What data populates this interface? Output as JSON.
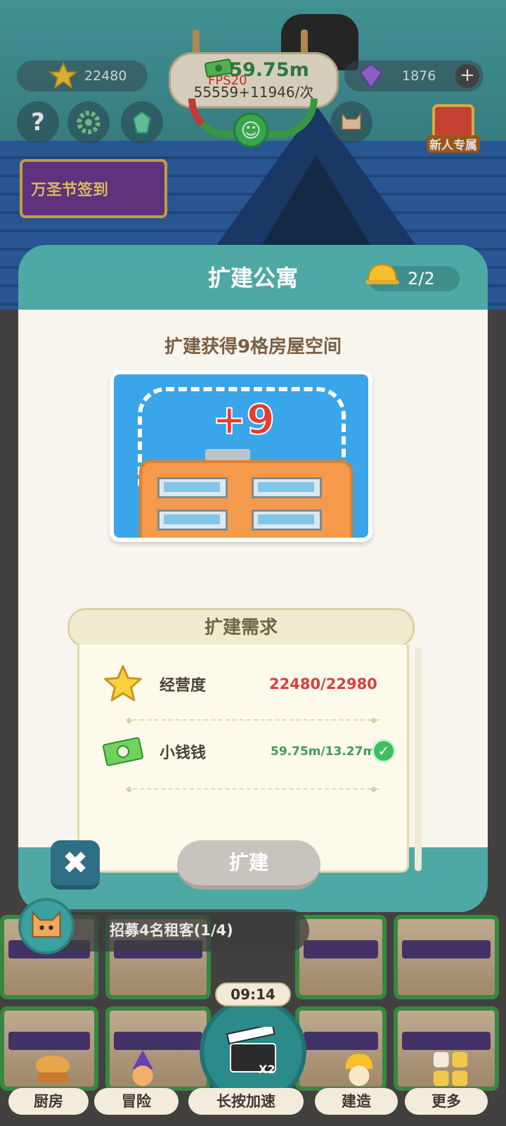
{
  "hud": {
    "stars": "22480",
    "money": "59.75m",
    "fps": "FPS20",
    "rate": "55559+11946/次",
    "gems": "1876"
  },
  "banners": {
    "halloween": "万圣节签到",
    "newbie": "新人专属"
  },
  "modal": {
    "title": "扩建公寓",
    "helmet_count": "2/2",
    "description": "扩建获得9格房屋空间",
    "preview_badge": "+9",
    "requirements_title": "扩建需求",
    "requirements": [
      {
        "name": "经营度",
        "value": "22480/22980",
        "met": false,
        "color": "#d9403a",
        "icon": "star-icon"
      },
      {
        "name": "小钱钱",
        "value": "59.75m/13.27m",
        "met": true,
        "color": "#3f9a5a",
        "icon": "cash-icon"
      }
    ],
    "build_label": "扩建",
    "close_icon": "close-icon"
  },
  "bottom": {
    "recruit": "招募4名租客(1/4)",
    "timer": "09:14",
    "speed_badge": "X2",
    "nav": [
      {
        "label": "厨房",
        "icon": "burger-cat-icon"
      },
      {
        "label": "冒险",
        "icon": "wizard-cat-icon"
      },
      {
        "label": "长按加速",
        "icon": "clapper-icon"
      },
      {
        "label": "建造",
        "icon": "builder-icon"
      },
      {
        "label": "更多",
        "icon": "grid-icon"
      }
    ]
  },
  "colors": {
    "modal_teal": "#4ea9a5",
    "money_green": "#2f8a4a",
    "unmet_red": "#d9403a",
    "met_green": "#3f9a5a"
  }
}
